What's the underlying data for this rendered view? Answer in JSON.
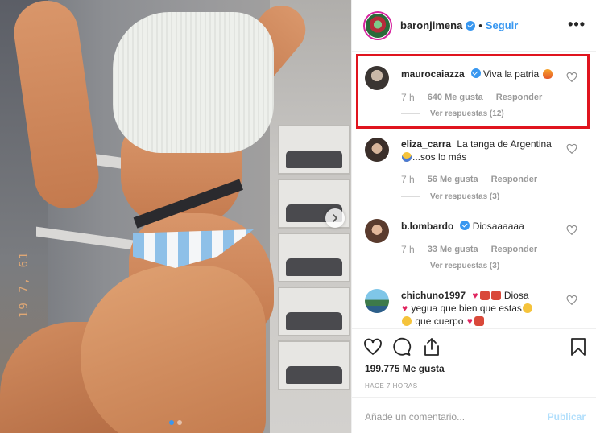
{
  "photo": {
    "date_stamp": "19 7, 61",
    "carousel_dots": 2,
    "active_dot": 0,
    "next_icon": "chevron-right-icon"
  },
  "header": {
    "username": "baronjimena",
    "bullet": "•",
    "follow_label": "Seguir",
    "more_icon": "ellipsis-icon",
    "more_label": "•••"
  },
  "comments": [
    {
      "user": "maurocaiazza",
      "verified": true,
      "text": "Viva la patria",
      "age": "7 h",
      "likes": "640 Me gusta",
      "reply_label": "Responder",
      "replies_label": "Ver respuestas (12)",
      "highlighted": true
    },
    {
      "user": "eliza_carra",
      "verified": false,
      "text": "La tanga de Argentina",
      "text_line2": "...sos lo más",
      "age": "7 h",
      "likes": "56 Me gusta",
      "reply_label": "Responder",
      "replies_label": "Ver respuestas (3)"
    },
    {
      "user": "b.lombardo",
      "verified": true,
      "text": "Diosaaaaaa",
      "age": "7 h",
      "likes": "33 Me gusta",
      "reply_label": "Responder",
      "replies_label": "Ver respuestas (3)"
    },
    {
      "user": "chichuno1997",
      "verified": false,
      "text": "Diosa",
      "text_line2": "yegua que bien que estas",
      "text_line3": "que cuerpo"
    }
  ],
  "actions": {
    "like_icon": "heart-icon",
    "comment_icon": "comment-icon",
    "share_icon": "share-icon",
    "save_icon": "bookmark-icon",
    "like_count": "199.775 Me gusta",
    "time_ago": "HACE 7 HORAS"
  },
  "add_comment": {
    "placeholder": "Añade un comentario...",
    "publish_label": "Publicar"
  },
  "colors": {
    "accent": "#3897f0",
    "highlight_border": "#e0141e",
    "publish_disabled": "#b2dffc",
    "muted_text": "#999999"
  }
}
